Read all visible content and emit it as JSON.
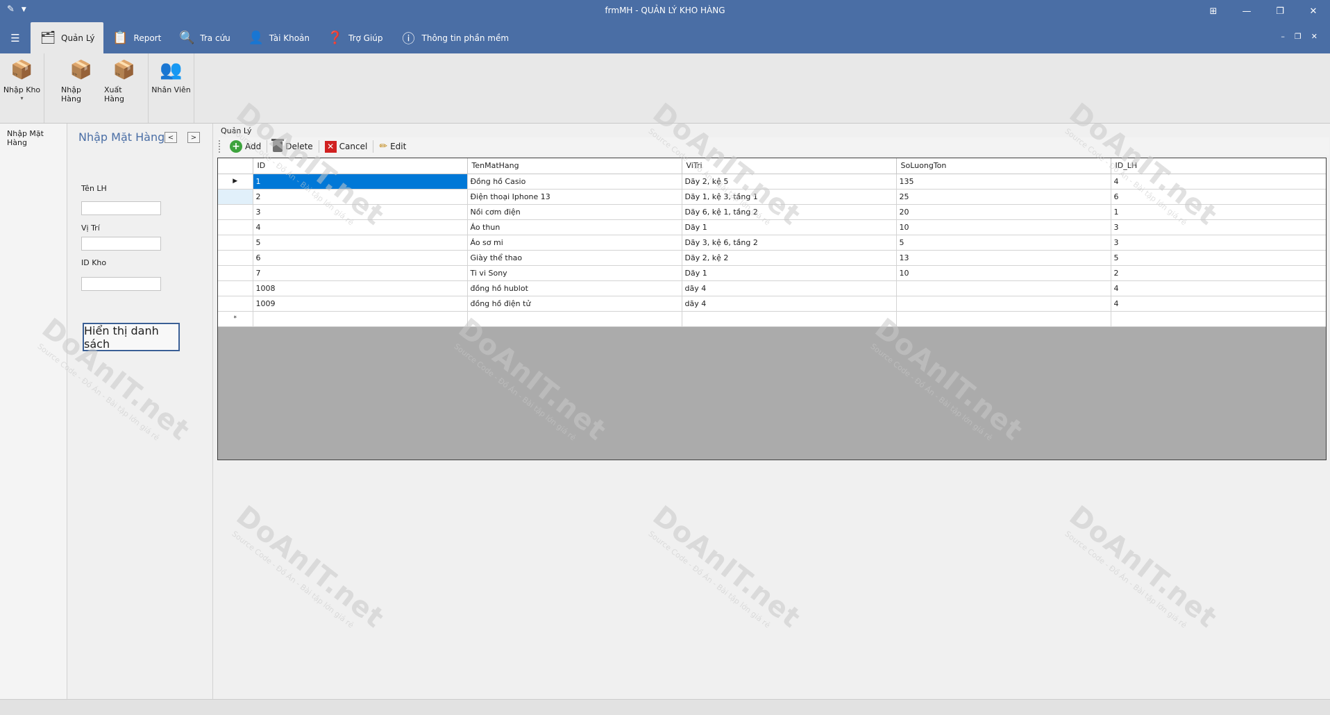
{
  "window": {
    "title": "frmMH - QUẢN LÝ KHO HÀNG",
    "controls": [
      "⊞",
      "—",
      "❐",
      "✕"
    ],
    "mdi_controls": [
      "–",
      "❐",
      "✕"
    ]
  },
  "tabs": [
    {
      "label": "Quản Lý",
      "icon": "folder-search-icon"
    },
    {
      "label": "Report",
      "icon": "clipboard-icon"
    },
    {
      "label": "Tra cứu",
      "icon": "magnifier-icon"
    },
    {
      "label": "Tài Khoản",
      "icon": "user-icon"
    },
    {
      "label": "Trợ Giúp",
      "icon": "help-icon"
    },
    {
      "label": "Thông tin phần mềm",
      "icon": "info-icon"
    }
  ],
  "ribbon": {
    "groups": [
      [
        {
          "label": "Nhập Kho",
          "icon": "warehouse-box-icon"
        }
      ],
      [
        {
          "label": "Nhập Hàng",
          "icon": "boxes-icon"
        },
        {
          "label": "Xuất Hàng",
          "icon": "box-export-icon"
        }
      ],
      [
        {
          "label": "Nhân Viên",
          "icon": "staff-icon"
        }
      ]
    ]
  },
  "leftnav": {
    "item": "Nhập Mặt Hàng"
  },
  "form": {
    "title": "Nhập Mặt Hàng",
    "prev": "<",
    "next": ">",
    "label_tenlh": "Tên LH",
    "label_vitri": "Vị Trí",
    "label_idkho": "ID Kho",
    "show_button": "Hiển thị danh sách"
  },
  "main": {
    "caption": "Quản Lý",
    "toolbar": {
      "add": "Add",
      "delete": "Delete",
      "cancel": "Cancel",
      "edit": "Edit"
    },
    "columns": [
      "ID",
      "TenMatHang",
      "ViTri",
      "SoLuongTon",
      "ID_LH"
    ],
    "rows": [
      [
        "1",
        "Đồng hồ Casio",
        "Dãy 2, kệ 5",
        "135",
        "4"
      ],
      [
        "2",
        "Điện thoại Iphone 13",
        "Dãy 1, kệ 3, tầng 1",
        "25",
        "6"
      ],
      [
        "3",
        "Nồi cơm điện",
        "Dãy 6, kệ 1, tầng 2",
        "20",
        "1"
      ],
      [
        "4",
        "Áo thun",
        "Dãy 1",
        "10",
        "3"
      ],
      [
        "5",
        "Áo sơ mi",
        "Dãy 3, kệ 6, tầng 2",
        "5",
        "3"
      ],
      [
        "6",
        "Giày thể thao",
        "Dãy 2, kệ 2",
        "13",
        "5"
      ],
      [
        "7",
        "Ti vi Sony",
        "Dãy 1",
        "10",
        "2"
      ],
      [
        "1008",
        "đồng hồ hublot",
        "dãy 4",
        "",
        "4"
      ],
      [
        "1009",
        "đồng hồ điện tử",
        "dãy 4",
        "",
        "4"
      ]
    ],
    "current_row_marker": "▶",
    "new_row_marker": "*"
  },
  "watermark": {
    "brand": "DoAnIT.net",
    "tagline": "Source Code - Đồ Án - Bài tập lớn giá rẻ"
  }
}
